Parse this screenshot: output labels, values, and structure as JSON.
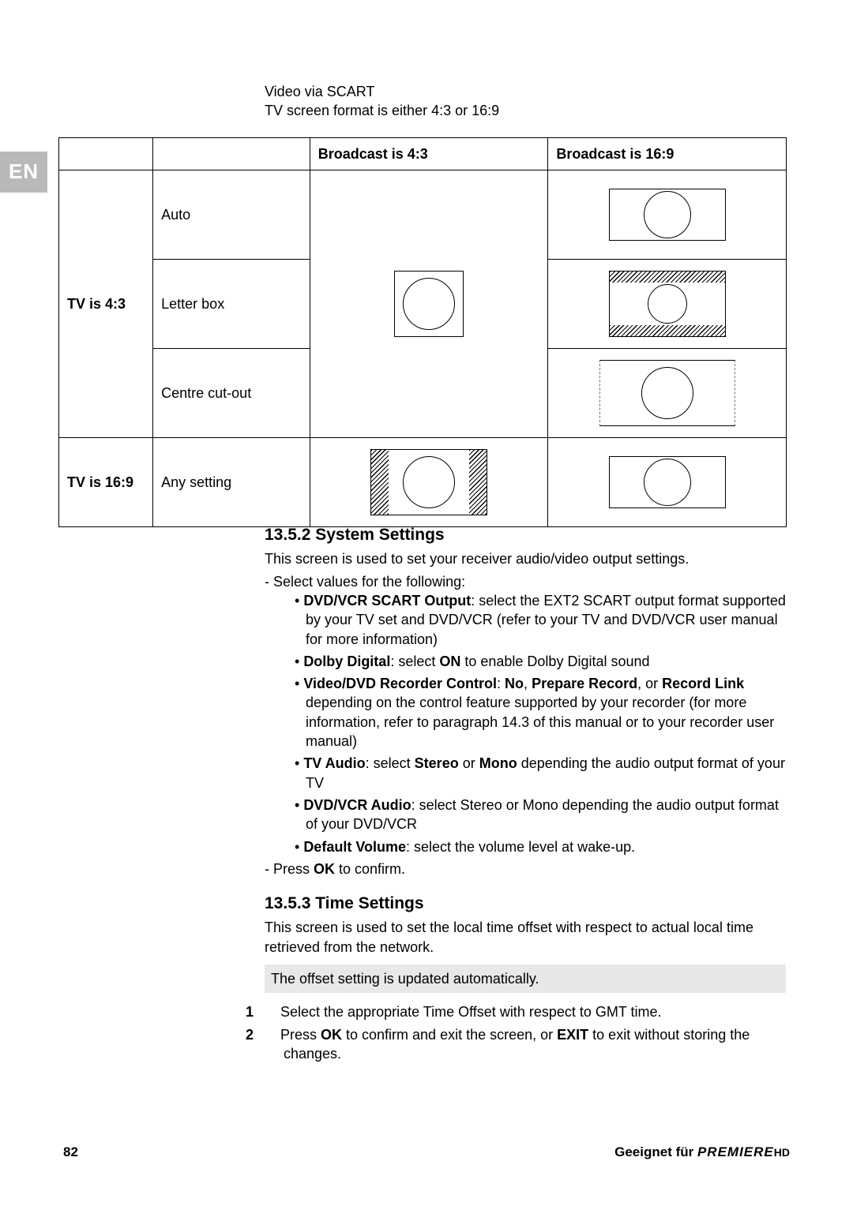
{
  "lang_tab": "EN",
  "intro": {
    "l1": "Video via SCART",
    "l2": "TV screen format is either 4:3 or 16:9"
  },
  "table": {
    "h_b43": "Broadcast is 4:3",
    "h_b169": "Broadcast is 16:9",
    "tv43": "TV is 4:3",
    "tv169": "TV is 16:9",
    "mode_auto": "Auto",
    "mode_lbox": "Letter box",
    "mode_cco": "Centre cut-out",
    "mode_any": "Any setting"
  },
  "sec1": {
    "h": "13.5.2 System Settings",
    "p": "This screen is used to set your receiver audio/video output settings.",
    "d1": "Select values for the following:",
    "b1a": "DVD/VCR SCART Output",
    "b1b": ": select the EXT2 SCART output format supported by your TV set and DVD/VCR (refer to your TV and DVD/VCR user manual for more information)",
    "b2a": "Dolby Digital",
    "b2b": ": select ",
    "b2c": "ON",
    "b2d": " to enable Dolby Digital sound",
    "b3a": "Video/DVD Recorder Control",
    "b3b": ": ",
    "b3c": "No",
    "b3d": ", ",
    "b3e": "Prepare Record",
    "b3f": ", or ",
    "b3g": "Record Link",
    "b3h": " depending on the control feature supported by your recorder (for more information, refer to paragraph 14.3 of this manual or to your recorder user manual)",
    "b4a": "TV Audio",
    "b4b": ": select ",
    "b4c": "Stereo",
    "b4d": " or ",
    "b4e": "Mono",
    "b4f": " depending the audio output format of your TV",
    "b5a": "DVD/VCR Audio",
    "b5b": ": select Stereo or Mono depending the audio output format of your DVD/VCR",
    "b6a": "Default Volume",
    "b6b": ": select the volume level at wake-up.",
    "d2a": "Press ",
    "d2b": "OK",
    "d2c": " to confirm."
  },
  "sec2": {
    "h": "13.5.3 Time Settings",
    "p": "This screen is used to set the local time offset with respect to actual local time retrieved from the network.",
    "note": "The offset setting is updated automatically.",
    "s1": "Select the appropriate Time Offset with respect to GMT time.",
    "s2a": "Press ",
    "s2b": "OK",
    "s2c": " to confirm and exit the screen, or ",
    "s2d": "EXIT",
    "s2e": " to exit without storing the changes."
  },
  "footer": {
    "page": "82",
    "geeignet": "Geeignet für ",
    "brand": "PREMIERE",
    "hd": "HD"
  }
}
